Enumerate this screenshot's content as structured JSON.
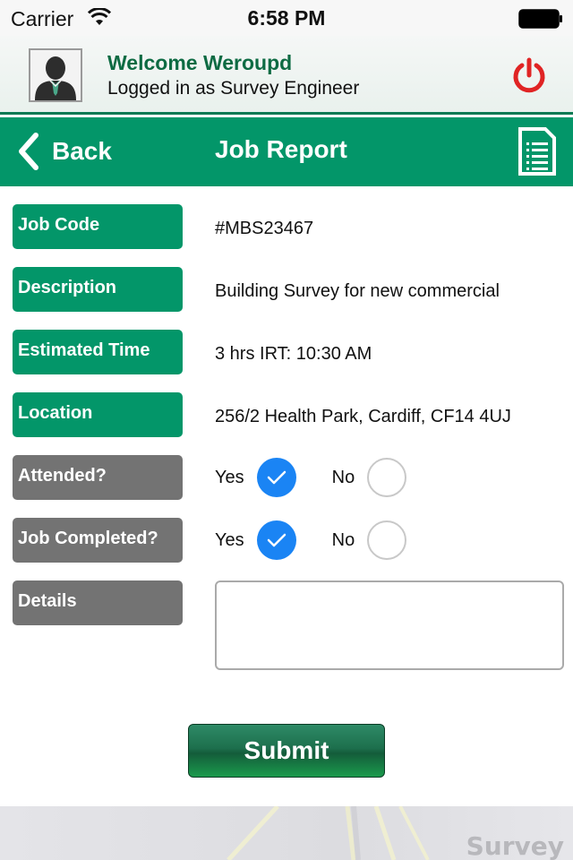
{
  "status_bar": {
    "carrier": "Carrier",
    "time": "6:58 PM",
    "icons": [
      "wifi-icon",
      "battery-icon"
    ]
  },
  "user_header": {
    "welcome": "Welcome Weroupd",
    "role": "Logged in as Survey Engineer",
    "avatar_icon": "user-avatar-icon",
    "logout_icon": "power-icon",
    "logout_color": "#e02424"
  },
  "nav_bar": {
    "back_label": "Back",
    "title": "Job Report",
    "right_icon": "document-list-icon",
    "color": "#039669"
  },
  "form": {
    "fields": [
      {
        "label": "Job Code",
        "value": "#MBS23467"
      },
      {
        "label": "Description",
        "value": "Building Survey for new commercial"
      },
      {
        "label": "Estimated Time",
        "value": "3 hrs IRT: 10:30 AM"
      },
      {
        "label": "Location",
        "value": "256/2 Health Park, Cardiff, CF14 4UJ"
      }
    ],
    "attended": {
      "label": "Attended?",
      "yes_label": "Yes",
      "no_label": "No",
      "selected": "Yes"
    },
    "job_completed": {
      "label": "Job Completed?",
      "yes_label": "Yes",
      "no_label": "No",
      "selected": "Yes"
    },
    "details": {
      "label": "Details",
      "value": "",
      "placeholder": ""
    }
  },
  "submit_label": "Submit",
  "footer": {
    "brand": "Survey"
  },
  "colors": {
    "accent_green": "#039669",
    "label_gray": "#737373",
    "radio_blue": "#1a84f4"
  }
}
